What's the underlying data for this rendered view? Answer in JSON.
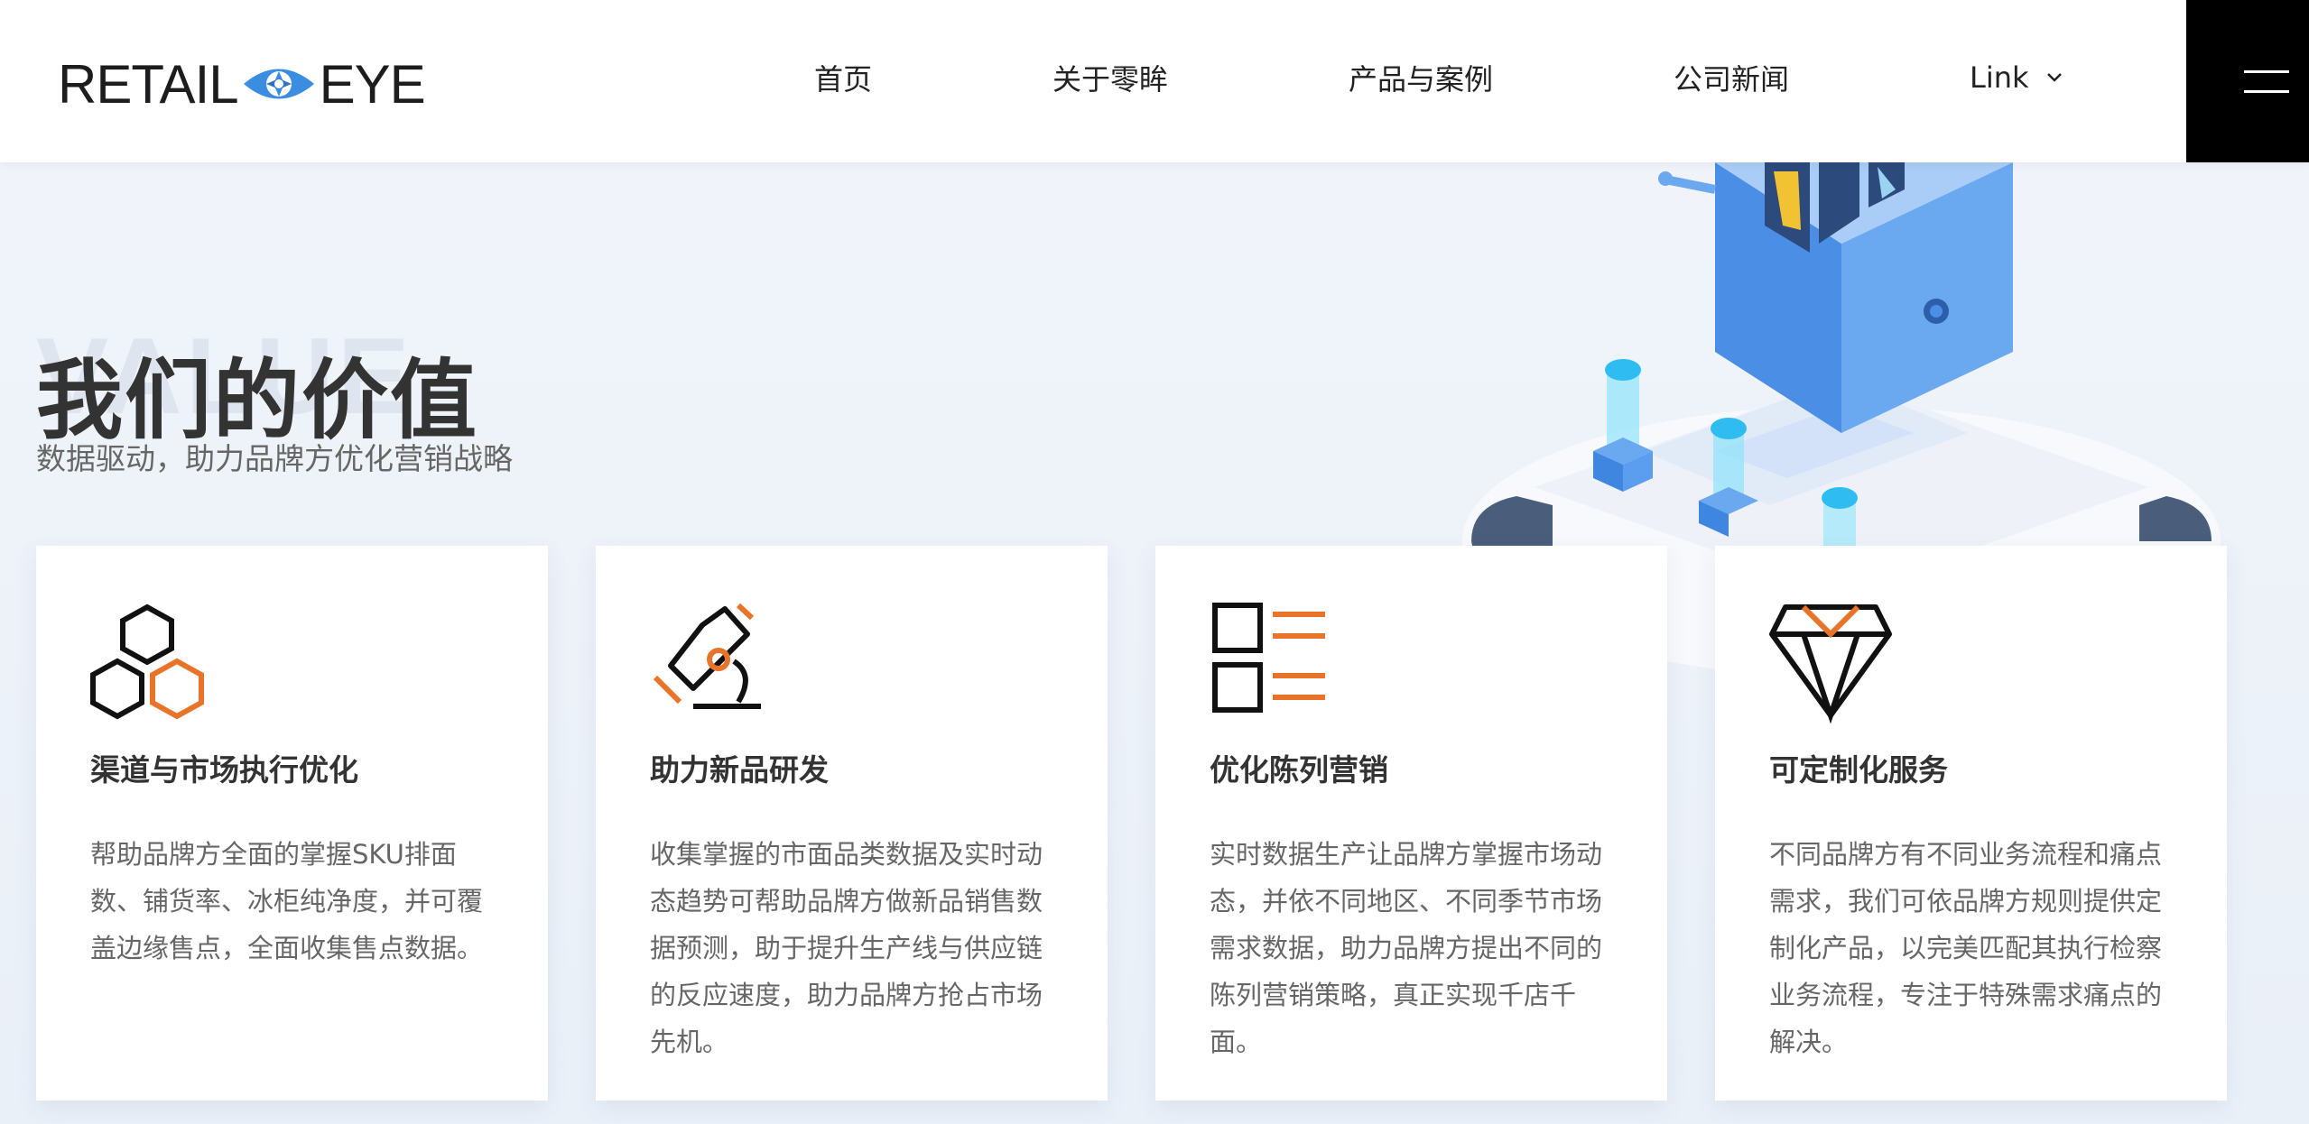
{
  "header": {
    "logo": {
      "left": "RETAIL",
      "right": "EYE"
    },
    "nav": [
      {
        "label": "首页"
      },
      {
        "label": "关于零眸"
      },
      {
        "label": "产品与案例"
      },
      {
        "label": "公司新闻"
      },
      {
        "label": "Link"
      }
    ]
  },
  "hero": {
    "bg_word": "VALUE",
    "title": "我们的价值",
    "subtitle": "数据驱动，助力品牌方优化营销战略"
  },
  "cards": [
    {
      "title": "渠道与市场执行优化",
      "desc": "帮助品牌方全面的掌握SKU排面数、铺货率、冰柜纯净度，并可覆盖边缘售点，全面收集售点数据。",
      "icon": "hexagons-icon"
    },
    {
      "title": "助力新品研发",
      "desc": "收集掌握的市面品类数据及实时动态趋势可帮助品牌方做新品销售数据预测，助于提升生产线与供应链的反应速度，助力品牌方抢占市场先机。",
      "icon": "microscope-icon"
    },
    {
      "title": "优化陈列营销",
      "desc": "实时数据生产让品牌方掌握市场动态，并依不同地区、不同季节市场需求数据，助力品牌方提出不同的陈列营销策略，真正实现千店千面。",
      "icon": "list-icon"
    },
    {
      "title": "可定制化服务",
      "desc": "不同品牌方有不同业务流程和痛点需求，我们可依品牌方规则提供定制化产品，以完美匹配其执行检察业务流程，专注于特殊需求痛点的解决。",
      "icon": "diamond-icon"
    }
  ],
  "colors": {
    "accent": "#e8742a",
    "logo_blue": "#3a8de0"
  }
}
